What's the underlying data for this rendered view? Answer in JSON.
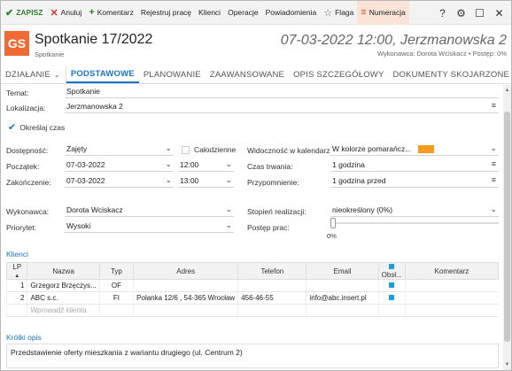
{
  "toolbar": {
    "save": "ZAPISZ",
    "cancel": "Anuluj",
    "comment": "Komentarz",
    "register": "Rejestruj pracę",
    "clients": "Klienci",
    "operations": "Operacje",
    "notifications": "Powiadomienia",
    "flag": "Flaga",
    "numbering": "Numeracja",
    "colors": {
      "save": "#2e7d32",
      "cancel": "#d32f2f",
      "comment": "#2e7d32",
      "active_bg": "#fbe3d8"
    }
  },
  "header": {
    "logo": "GS",
    "title": "Spotkanie 17/2022",
    "subtitle": "Spotkanie",
    "datetime_location": "07-03-2022 12:00, Jerzmanowska 2",
    "meta": "Wykonawca: Dorota Wciskacz  •  Postęp: 0%",
    "logo_color": "#f06a35"
  },
  "tabs": [
    {
      "label": "DZIAŁANIE",
      "has_dropdown": true
    },
    {
      "label": "PODSTAWOWE",
      "active": true
    },
    {
      "label": "PLANOWANIE"
    },
    {
      "label": "ZAAWANSOWANE"
    },
    {
      "label": "OPIS SZCZEGÓŁOWY"
    },
    {
      "label": "DOKUMENTY SKOJARZONE"
    }
  ],
  "form": {
    "temat_label": "Temat:",
    "temat_value": "Spotkanie",
    "lokalizacja_label": "Lokalizacja:",
    "lokalizacja_value": "Jerzmanowska 2",
    "okreslaj_czas": "Określaj czas",
    "dostepnosc_label": "Dostępność:",
    "dostepnosc_value": "Zajęty",
    "calodzienne": "Całodzienne",
    "poczatek_label": "Początek:",
    "poczatek_date": "07-03-2022",
    "poczatek_time": "12:00",
    "zakonczenie_label": "Zakończenie:",
    "zakonczenie_date": "07-03-2022",
    "zakonczenie_time": "13:00",
    "widocznosc_label": "Widoczność w kalendarzu:",
    "widocznosc_value": "W kolorze pomarańcz...",
    "czas_trwania_label": "Czas trwania:",
    "czas_trwania_value": "1 godzina",
    "przypomnienie_label": "Przypomnienie:",
    "przypomnienie_value": "1 godzina przed",
    "wykonawca_label": "Wykonawca:",
    "wykonawca_value": "Dorota Wciskacz",
    "priorytet_label": "Priorytet:",
    "priorytet_value": "Wysoki",
    "stopien_label": "Stopień realizacji:",
    "stopien_value": "nieokreślony  (0%)",
    "postep_label": "Postęp prac:",
    "postep_value": "0%",
    "postep_fraction": 0,
    "orange_color": "#f59a23"
  },
  "clients": {
    "section_label": "Klienci",
    "columns": [
      "LP",
      "Nazwa",
      "Typ",
      "Adres",
      "Telefon",
      "Email",
      "Obsł...",
      "Komentarz"
    ],
    "rows": [
      {
        "lp": "1",
        "nazwa": "Grzegorz Brzęczys...",
        "typ": "OF",
        "adres": "",
        "telefon": "",
        "email": "",
        "obsl": true,
        "komentarz": ""
      },
      {
        "lp": "2",
        "nazwa": "ABC s.c.",
        "typ": "FI",
        "adres": "Polanka  12/6 , 54-365 Wrocław",
        "telefon": "456-46-55",
        "email": "info@abc.insert.pl",
        "obsl": true,
        "komentarz": ""
      }
    ],
    "placeholder": "Wprowadź klienta"
  },
  "krotki_opis": {
    "section_label": "Krótki opis",
    "text": "Przedstawienie oferty mieszkania z wariantu drugiego (ul. Centrum 2)"
  }
}
